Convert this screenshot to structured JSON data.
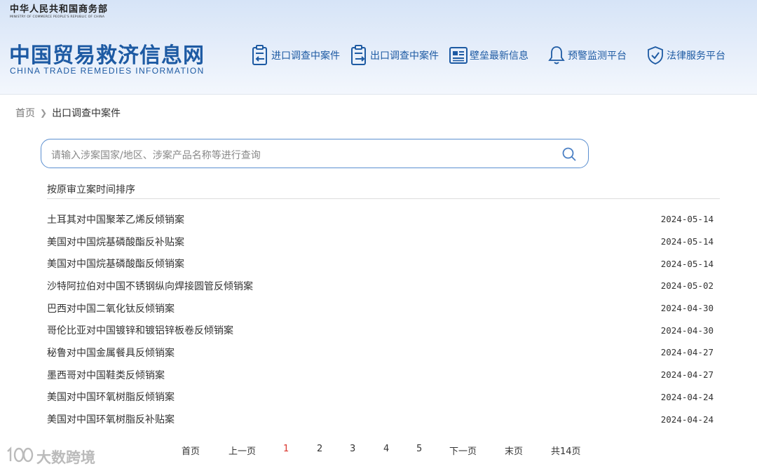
{
  "ministry": {
    "cn": "中华人民共和国商务部",
    "en": "MINISTRY OF COMMERCE PEOPLE'S REPUBLIC OF CHINA"
  },
  "site": {
    "title_cn": "中国贸易救济信息网",
    "title_en": "CHINA TRADE REMEDIES INFORMATION",
    "brand_color": "#1d5aa3"
  },
  "nav": [
    {
      "label": "进口调查中案件",
      "icon": "import-document-icon"
    },
    {
      "label": "出口调查中案件",
      "icon": "export-document-icon"
    },
    {
      "label": "壁垒最新信息",
      "icon": "news-icon"
    },
    {
      "label": "预警监测平台",
      "icon": "bell-icon"
    },
    {
      "label": "法律服务平台",
      "icon": "shield-check-icon"
    }
  ],
  "breadcrumb": {
    "home": "首页",
    "current": "出口调查中案件"
  },
  "search": {
    "placeholder": "请输入涉案国家/地区、涉案产品名称等进行查询"
  },
  "sort_label": "按原审立案时间排序",
  "cases": [
    {
      "title": "土耳其对中国聚苯乙烯反倾销案",
      "date": "2024-05-14"
    },
    {
      "title": "美国对中国烷基磷酸酯反补贴案",
      "date": "2024-05-14"
    },
    {
      "title": "美国对中国烷基磷酸酯反倾销案",
      "date": "2024-05-14"
    },
    {
      "title": "沙特阿拉伯对中国不锈钢纵向焊接圆管反倾销案",
      "date": "2024-05-02"
    },
    {
      "title": "巴西对中国二氧化钛反倾销案",
      "date": "2024-04-30"
    },
    {
      "title": "哥伦比亚对中国镀锌和镀铝锌板卷反倾销案",
      "date": "2024-04-30"
    },
    {
      "title": "秘鲁对中国金属餐具反倾销案",
      "date": "2024-04-27"
    },
    {
      "title": "墨西哥对中国鞋类反倾销案",
      "date": "2024-04-27"
    },
    {
      "title": "美国对中国环氧树脂反倾销案",
      "date": "2024-04-24"
    },
    {
      "title": "美国对中国环氧树脂反补贴案",
      "date": "2024-04-24"
    }
  ],
  "pagination": {
    "first": "首页",
    "prev": "上一页",
    "pages": [
      "1",
      "2",
      "3",
      "4",
      "5"
    ],
    "current": "1",
    "next": "下一页",
    "last": "末页",
    "total": "共14页",
    "active_color": "#d9342b"
  },
  "watermark": "大数跨境"
}
